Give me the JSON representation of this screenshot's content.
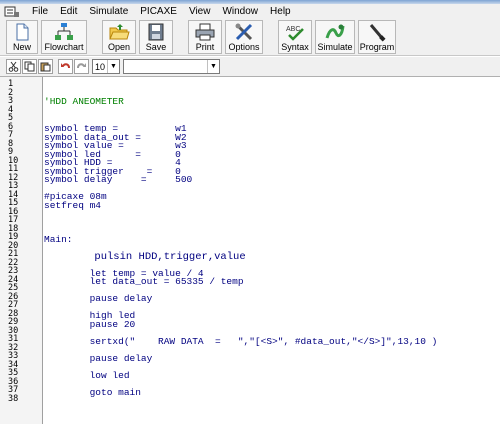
{
  "menu": [
    "File",
    "Edit",
    "Simulate",
    "PICAXE",
    "View",
    "Window",
    "Help"
  ],
  "toolbar": {
    "new": "New",
    "flowchart": "Flowchart",
    "open": "Open",
    "save": "Save",
    "print": "Print",
    "options": "Options",
    "syntax": "Syntax",
    "simulate": "Simulate",
    "program": "Program"
  },
  "font_size": "10",
  "font_name": "",
  "line_numbers": [
    "1",
    "2",
    "3",
    "4",
    "5",
    "6",
    "7",
    "8",
    "9",
    "10",
    "11",
    "12",
    "13",
    "14",
    "15",
    "16",
    "17",
    "18",
    "19",
    "20",
    "21",
    "22",
    "23",
    "24",
    "25",
    "26",
    "27",
    "28",
    "29",
    "30",
    "31",
    "32",
    "33",
    "34",
    "35",
    "36",
    "37",
    "38"
  ],
  "code": {
    "l3": "'HDD ANEOMETER",
    "l6": "symbol temp =          w1",
    "l7": "symbol data_out =      W2",
    "l8": "symbol value =         w3",
    "l9": "symbol led      =      0",
    "l10": "symbol HDD =           4",
    "l11": "symbol trigger    =    0",
    "l12": "symbol delay     =     500",
    "l14": "#picaxe 08m",
    "l15": "setfreq m4",
    "l19": "Main:",
    "l21": "        pulsin HDD,trigger,value",
    "l23": "        let temp = value / 4",
    "l24": "        let data_out = 65335 / temp",
    "l26": "        pause delay",
    "l28": "        high led",
    "l29": "        pause 20",
    "l31": "        sertxd(\"    RAW DATA  =   \",\"[<S>\", #data_out,\"</S>]\",13,10 )",
    "l33": "        pause delay",
    "l35": "        low led",
    "l37": "        goto main"
  }
}
